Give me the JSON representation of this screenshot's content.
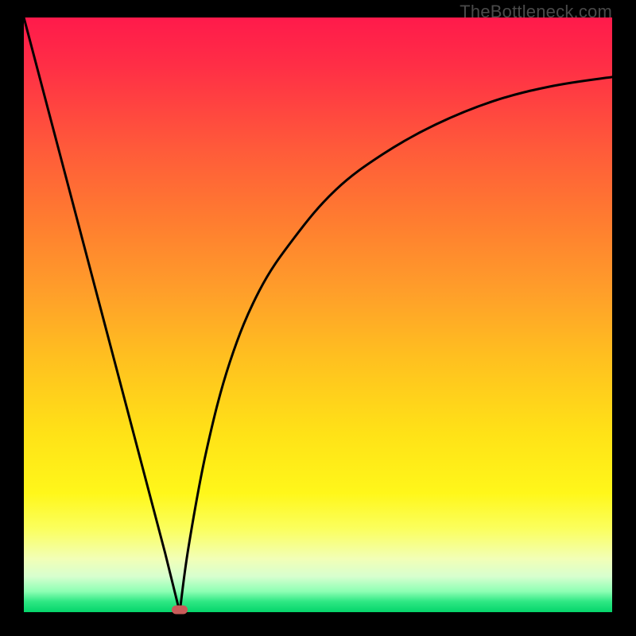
{
  "watermark": "TheBottleneck.com",
  "colors": {
    "frame": "#000000",
    "curve": "#000000",
    "marker": "#c95b59"
  },
  "chart_data": {
    "type": "line",
    "title": "",
    "xlabel": "",
    "ylabel": "",
    "xlim": [
      0,
      100
    ],
    "ylim": [
      0,
      100
    ],
    "grid": false,
    "legend": false,
    "series": [
      {
        "name": "left-branch",
        "x": [
          0,
          4,
          8,
          12,
          16,
          20,
          24,
          26.5
        ],
        "values": [
          100,
          85,
          70,
          55,
          40,
          25,
          10,
          0
        ]
      },
      {
        "name": "right-branch",
        "x": [
          26.5,
          28,
          31,
          35,
          40,
          46,
          53,
          61,
          70,
          80,
          90,
          100
        ],
        "values": [
          0,
          11,
          27,
          42,
          54,
          63,
          71,
          77,
          82,
          86,
          88.5,
          90
        ]
      }
    ],
    "markers": [
      {
        "name": "min-point",
        "x": 26.5,
        "y": 0
      }
    ],
    "background_gradient": {
      "direction": "top-to-bottom",
      "stops": [
        {
          "pos": 0.0,
          "color": "#ff1a4b"
        },
        {
          "pos": 0.5,
          "color": "#ffbf20"
        },
        {
          "pos": 0.85,
          "color": "#fbff5e"
        },
        {
          "pos": 1.0,
          "color": "#05d56b"
        }
      ]
    }
  }
}
